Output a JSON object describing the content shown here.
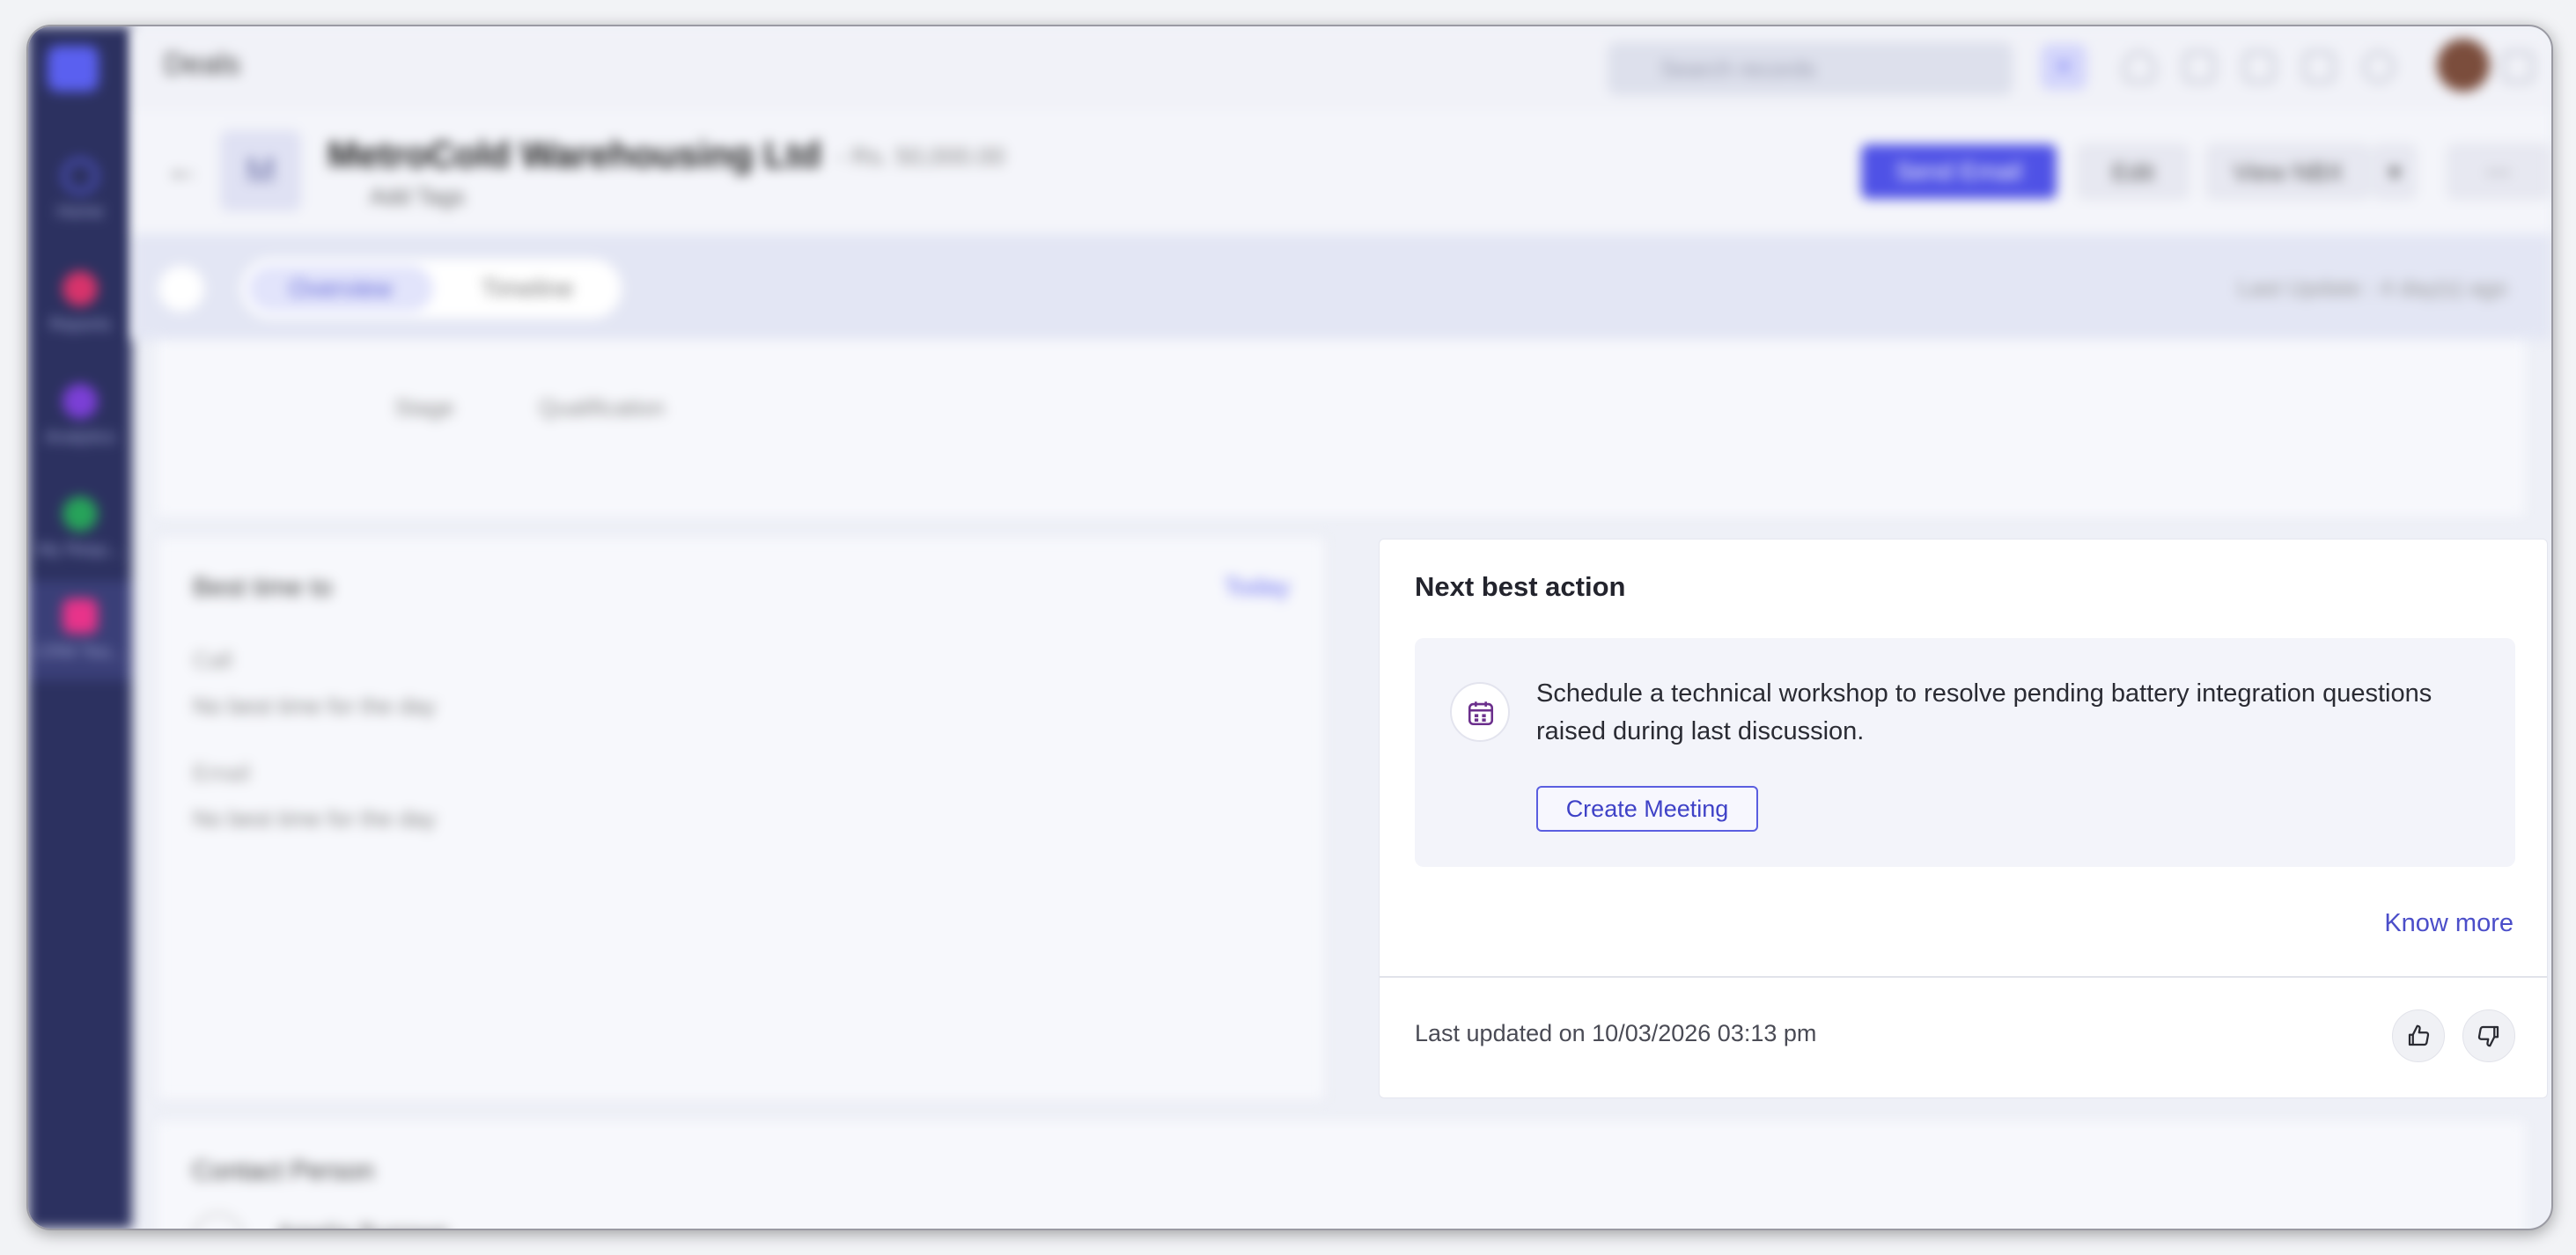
{
  "sidebar": {
    "items": [
      {
        "label": "Home",
        "color": "#5b5fe8"
      },
      {
        "label": "Reports",
        "color": "#d8336b"
      },
      {
        "label": "Analytics",
        "color": "#7b3fd6"
      },
      {
        "label": "My Requ...",
        "color": "#27a35a"
      },
      {
        "label": "CRM Tea...",
        "color": "#e8338a"
      }
    ]
  },
  "topbar": {
    "title": "Deals",
    "search_placeholder": "Search records",
    "plus_label": "+"
  },
  "header": {
    "avatar_letter": "M",
    "deal_name": "MetroCold Warehousing Ltd",
    "amount": "- Rs. 50,000.00",
    "add_tags": "Add Tags",
    "send_email": "Send Email",
    "edit": "Edit",
    "view_nbx": "View NBX",
    "more": "⋯"
  },
  "tabs": {
    "overview": "Overview",
    "timeline": "Timeline",
    "last_update": "Last Update : 4 day(s) ago"
  },
  "stage": {
    "label": "Stage",
    "value": "Qualification"
  },
  "best_time": {
    "title": "Best time to",
    "today": "Today",
    "call_label": "Call",
    "call_value": "No best time for the day",
    "email_label": "Email",
    "email_value": "No best time for the day"
  },
  "next_best_action": {
    "title": "Next best action",
    "suggestion": "Schedule a technical workshop to resolve pending battery integration questions raised during last discussion.",
    "create_button": "Create Meeting",
    "know_more": "Know more",
    "last_updated": "Last updated on 10/03/2026 03:13 pm"
  },
  "contact": {
    "title": "Contact Person",
    "name": "Amelia Burrows"
  },
  "colors": {
    "accent": "#4f52e6",
    "sidebar": "#2c3160"
  }
}
